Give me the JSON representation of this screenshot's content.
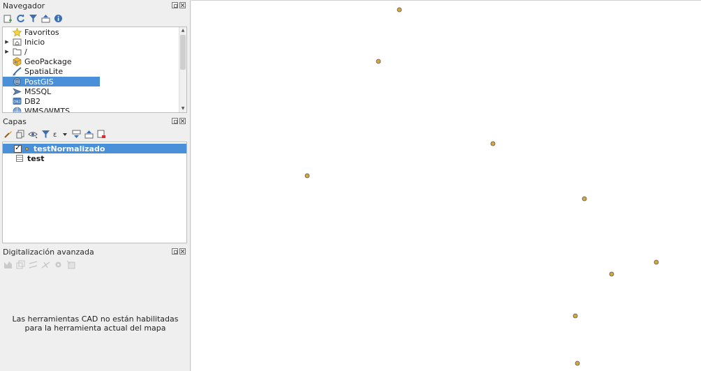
{
  "browser_panel": {
    "title": "Navegador",
    "toolbar_icons": [
      "add-layer-icon",
      "refresh-icon",
      "filter-icon",
      "collapse-all-icon",
      "info-icon"
    ],
    "items": [
      {
        "label": "Favoritos",
        "icon": "star-icon",
        "expandable": false
      },
      {
        "label": "Inicio",
        "icon": "home-folder-icon",
        "expandable": true
      },
      {
        "label": "/",
        "icon": "folder-icon",
        "expandable": true
      },
      {
        "label": "GeoPackage",
        "icon": "geopackage-icon",
        "expandable": false
      },
      {
        "label": "SpatiaLite",
        "icon": "spatialite-icon",
        "expandable": false
      },
      {
        "label": "PostGIS",
        "icon": "postgis-icon",
        "expandable": false,
        "selected": true
      },
      {
        "label": "MSSQL",
        "icon": "mssql-icon",
        "expandable": false
      },
      {
        "label": "DB2",
        "icon": "db2-icon",
        "expandable": false
      },
      {
        "label": "WMS/WMTS",
        "icon": "wms-icon",
        "expandable": false
      }
    ]
  },
  "layers_panel": {
    "title": "Capas",
    "toolbar_icons": [
      "style-icon",
      "add-group-icon",
      "visibility-icon",
      "filter-layer-icon",
      "expression-filter-icon",
      "expand-all-icon",
      "collapse-all-icon",
      "remove-layer-icon"
    ],
    "layers": [
      {
        "name": "testNormalizado",
        "checked": true,
        "type": "point",
        "selected": true
      },
      {
        "name": "test",
        "type": "table"
      }
    ]
  },
  "digitizing_panel": {
    "title": "Digitalización avanzada",
    "message": "Las herramientas CAD no están habilitadas para la herramienta actual del mapa"
  },
  "map_canvas": {
    "point_color": "#d4a93a",
    "point_count": 9
  },
  "colors": {
    "selection": "#4a90d9"
  }
}
